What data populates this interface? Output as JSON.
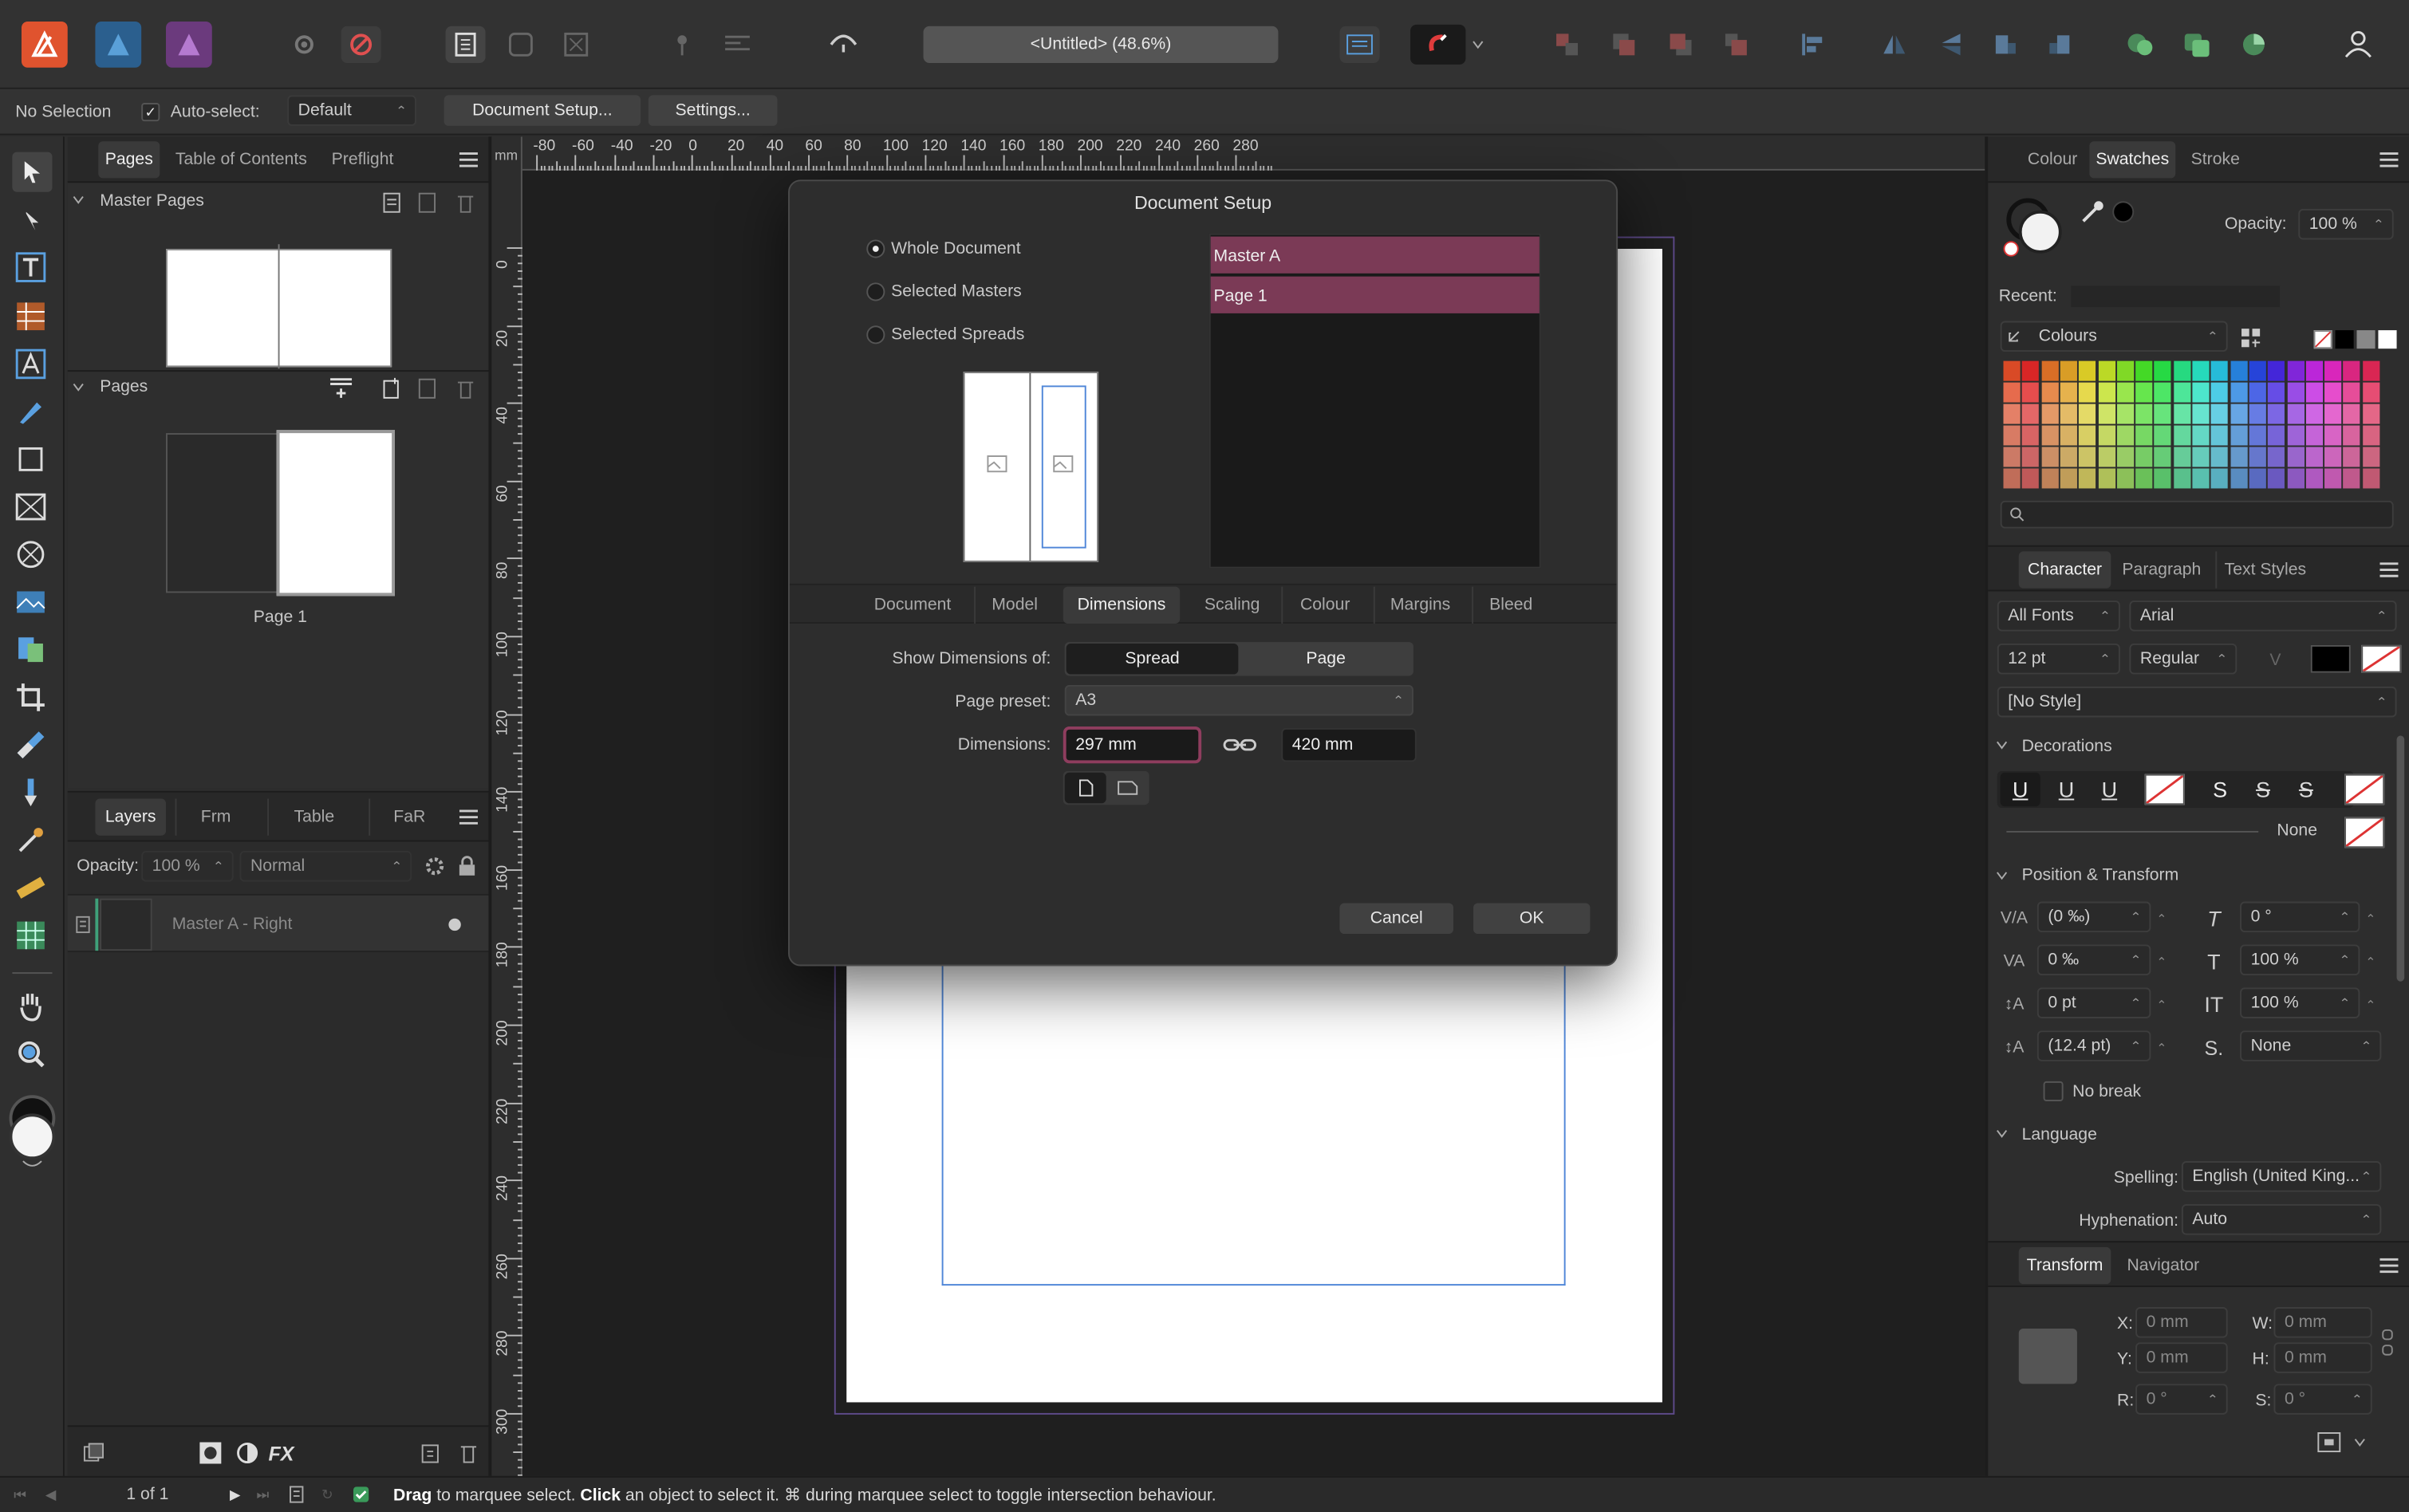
{
  "titlebar": {
    "document_title": "<Untitled> (48.6%)"
  },
  "contextbar": {
    "selection": "No Selection",
    "autoselect_label": "Auto-select:",
    "autoselect_value": "Default",
    "doc_setup_button": "Document Setup...",
    "settings_button": "Settings..."
  },
  "left_panel": {
    "tabs": [
      "Pages",
      "Table of Contents",
      "Preflight"
    ],
    "master_pages_title": "Master Pages",
    "pages_title": "Pages",
    "page_label": "Page 1"
  },
  "layers_panel": {
    "tabs": [
      "Layers",
      "Frm",
      "Table",
      "FaR"
    ],
    "opacity_label": "Opacity:",
    "opacity_value": "100 %",
    "blend_mode": "Normal",
    "layer_name": "Master A - Right"
  },
  "ruler": {
    "unit": "mm",
    "h_ticks": [
      "-80",
      "-60",
      "-40",
      "-20",
      "0",
      "20",
      "40",
      "60",
      "80",
      "100",
      "120",
      "140",
      "160",
      "180",
      "200",
      "220",
      "240",
      "260",
      "280"
    ],
    "v_ticks": [
      "0",
      "20",
      "40",
      "60",
      "80",
      "100",
      "120",
      "140",
      "160",
      "180",
      "200",
      "220",
      "240",
      "260",
      "280",
      "300"
    ]
  },
  "dialog": {
    "title": "Document Setup",
    "scope_options": [
      "Whole Document",
      "Selected Masters",
      "Selected Spreads"
    ],
    "list_items": [
      "Master A",
      "Page 1"
    ],
    "tabs": [
      "Document",
      "Model",
      "Dimensions",
      "Scaling",
      "Colour",
      "Margins",
      "Bleed"
    ],
    "show_dims_label": "Show Dimensions of:",
    "show_dims_options": [
      "Spread",
      "Page"
    ],
    "preset_label": "Page preset:",
    "preset_value": "A3",
    "dims_label": "Dimensions:",
    "width": "297 mm",
    "height": "420 mm",
    "cancel": "Cancel",
    "ok": "OK"
  },
  "right_panel": {
    "colour_tabs": [
      "Colour",
      "Swatches",
      "Stroke"
    ],
    "opacity_label": "Opacity:",
    "opacity_value": "100 %",
    "recent_label": "Recent:",
    "palette_name": "Colours",
    "char_tabs": [
      "Character",
      "Paragraph",
      "Text Styles"
    ],
    "font_collection": "All Fonts",
    "font_family": "Arial",
    "font_size": "12 pt",
    "font_weight": "Regular",
    "para_style": "[No Style]",
    "decorations_title": "Decorations",
    "decoration_none": "None",
    "pos_title": "Position & Transform",
    "tracking": "(0 ‰)",
    "kerning": "0 ‰",
    "baseline": "0 pt",
    "leading": "(12.4 pt)",
    "shear": "0 °",
    "v_scale": "100 %",
    "h_scale": "100 %",
    "super": "None",
    "no_break": "No break",
    "language_title": "Language",
    "spelling_label": "Spelling:",
    "spelling_value": "English (United King...",
    "hyph_label": "Hyphenation:",
    "hyph_value": "Auto",
    "transform_tabs": [
      "Transform",
      "Navigator"
    ],
    "x_label": "X:",
    "x": "0 mm",
    "y_label": "Y:",
    "y": "0 mm",
    "w_label": "W:",
    "w": "0 mm",
    "h_label": "H:",
    "h": "0 mm",
    "r_label": "R:",
    "r": "0 °",
    "s_label": "S:",
    "s": "0 °"
  },
  "statusbar": {
    "page": "1 of 1",
    "hint_drag": "Drag",
    "hint_1": " to marquee select. ",
    "hint_click": "Click",
    "hint_2": " an object to select it. ⌘ during marquee select to toggle intersection behaviour."
  },
  "colors": {
    "accent": "#8e3d5e",
    "selection_blue": "#3f7fe0"
  }
}
